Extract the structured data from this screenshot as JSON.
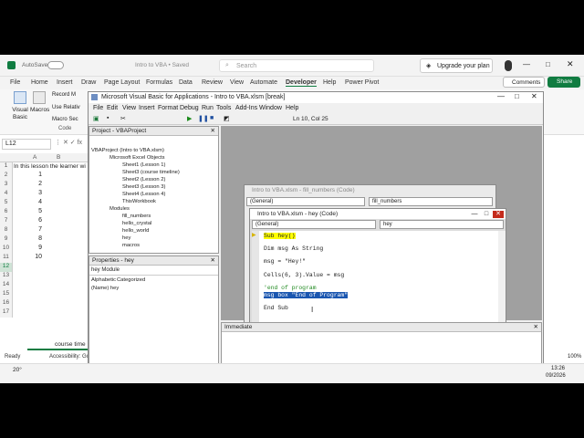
{
  "excel": {
    "autosave": "AutoSave",
    "file_name": "Intro to VBA • Saved",
    "search_placeholder": "Search",
    "upgrade": "Upgrade your plan",
    "tabs": [
      "File",
      "Home",
      "Insert",
      "Draw",
      "Page Layout",
      "Formulas",
      "Data",
      "Review",
      "View",
      "Automate",
      "Developer",
      "Help",
      "Power Pivot"
    ],
    "comments": "Comments",
    "share": "Share",
    "ribbon": {
      "visual_basic": "Visual Basic",
      "macros": "Macros",
      "record": "Record M",
      "use_relative": "Use Relativ",
      "macro_sec": "Macro Sec",
      "group": "Code"
    },
    "name_box": "L12",
    "row1_text": "In this lesson the learner wi",
    "rows": [
      "1",
      "2",
      "3",
      "4",
      "5",
      "6",
      "7",
      "8",
      "9",
      "10",
      "11",
      "12",
      "13",
      "14",
      "15",
      "16",
      "17"
    ],
    "numbers": [
      "1",
      "2",
      "3",
      "4",
      "5",
      "6",
      "7",
      "8",
      "9",
      "10"
    ],
    "col_a": "A",
    "col_b": "B",
    "sheet_tab": "course time",
    "status_ready": "Ready",
    "accessibility": "Accessibility: Goo",
    "zoom": "100%",
    "time": "13:26",
    "date": "09/2026",
    "temp": "20°"
  },
  "vba": {
    "title": "Microsoft Visual Basic for Applications - Intro to VBA.xlsm [break]",
    "menu": [
      "File",
      "Edit",
      "View",
      "Insert",
      "Format",
      "Debug",
      "Run",
      "Tools",
      "Add-Ins",
      "Window",
      "Help"
    ],
    "position": "Ln 10, Col 25",
    "project_title": "Project - VBAProject",
    "tree": {
      "root": "VBAProject (Intro to VBA.xlsm)",
      "excel_objects": "Microsoft Excel Objects",
      "sheets": [
        "Sheet1 (Lesson 1)",
        "Sheet3 (course timeline)",
        "Sheet2 (Lesson 2)",
        "Sheet3 (Lesson 3)",
        "Sheet4 (Lesson 4)",
        "ThisWorkbook"
      ],
      "modules_label": "Modules",
      "modules": [
        "fill_numbers",
        "hello_crystal",
        "hello_world",
        "hey",
        "macros"
      ]
    },
    "props_title": "Properties - hey",
    "props_object": "hey Module",
    "props_tabs": [
      "Alphabetic",
      "Categorized"
    ],
    "props_name": "(Name) hey",
    "immediate": "Immediate",
    "back_window": {
      "title": "Intro to VBA.xlsm - fill_numbers (Code)",
      "left_combo": "(General)",
      "right_combo": "fill_numbers"
    },
    "code_window": {
      "title": "Intro to VBA.xlsm - hey (Code)",
      "left_combo": "(General)",
      "right_combo": "hey",
      "lines": [
        "Sub hey()",
        "Dim msg As String",
        "msg = \"Hey!\"",
        "Cells(6, 3).Value = msg",
        "'end of program",
        "msg box \"End of Program\"",
        "End Sub"
      ]
    }
  }
}
